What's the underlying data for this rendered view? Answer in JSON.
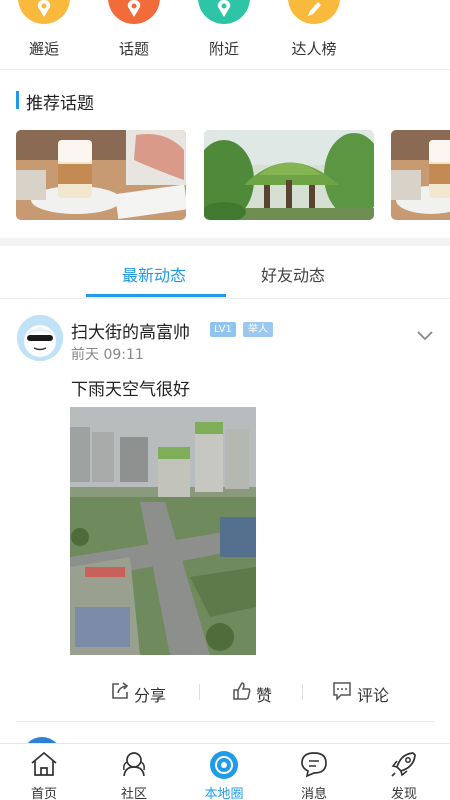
{
  "top_icons": [
    {
      "label": "邂逅",
      "icon": "location-heart-icon",
      "color": "#f9b93c"
    },
    {
      "label": "话题",
      "icon": "location-topic-icon",
      "color": "#f26b3a"
    },
    {
      "label": "附近",
      "icon": "location-nearby-icon",
      "color": "#2ec4a6"
    },
    {
      "label": "达人榜",
      "icon": "pen-ranking-icon",
      "color": "#f9b93c"
    }
  ],
  "recommended": {
    "title": "推荐话题"
  },
  "tabs": {
    "latest": "最新动态",
    "friends": "好友动态"
  },
  "post": {
    "username": "扫大街的高富帅",
    "level_badge": "LV1",
    "role_badge": "举人",
    "time": "前天 09:11",
    "text": "下雨天空气很好",
    "actions": {
      "share": "分享",
      "like": "赞",
      "comment": "评论"
    }
  },
  "bottom_nav": [
    {
      "label": "首页",
      "icon": "home-icon",
      "active": false
    },
    {
      "label": "社区",
      "icon": "community-icon",
      "active": false
    },
    {
      "label": "本地圈",
      "icon": "local-circle-icon",
      "active": true
    },
    {
      "label": "消息",
      "icon": "message-icon",
      "active": false
    },
    {
      "label": "发现",
      "icon": "rocket-icon",
      "active": false
    }
  ],
  "colors": {
    "accent": "#1e9be9",
    "level_badge": "#8fc3f0",
    "role_badge": "#9cc8ee"
  }
}
